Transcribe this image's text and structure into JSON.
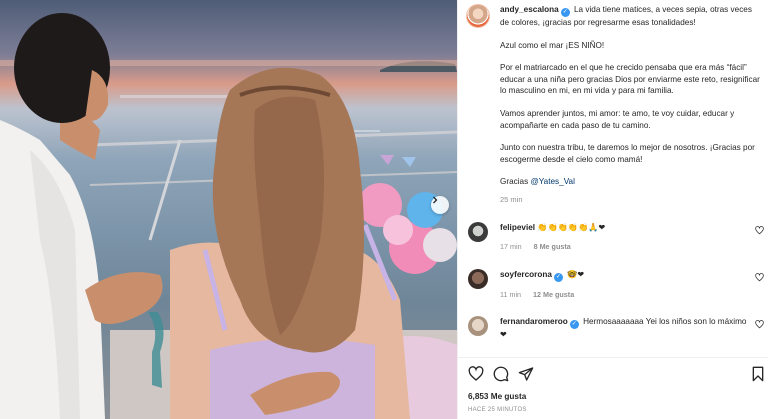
{
  "post": {
    "username": "andy_escalona",
    "caption_intro": "La vida tiene matices, a veces sepia, otras veces de colores, ¡gracias por regresarme esas tonalidades!",
    "paragraphs": [
      "Azul como el mar ¡ES NIÑO!",
      "Por el matriarcado en el que he crecido pensaba que era más “fácil” educar a una niña pero gracias Dios por enviarme este reto, resignificar lo masculino en mi, en mi vida y para mi familia.",
      "Vamos aprender juntos, mi amor: te amo, te voy cuidar, educar y acompañarte en cada paso de tu camino.",
      "Junto con nuestra tribu, te daremos lo mejor de nosotros. ¡Gracias por escogerme desde el cielo como mamá!"
    ],
    "thanks_prefix": "Gracias",
    "thanks_mention": "@Yates_Val",
    "time": "25 min"
  },
  "comments": [
    {
      "username": "felipeviel",
      "text": "👏👏👏👏👏🙏❤",
      "time": "17 min",
      "likes": "8 Me gusta"
    },
    {
      "username": "soyfercorona",
      "text": "🤓❤",
      "time": "11 min",
      "likes": "12 Me gusta"
    },
    {
      "username": "fernandaromeroo",
      "text": "Hermosaaaaaaa Yei los niños son lo máximo ❤"
    }
  ],
  "footer": {
    "likes": "6,853 Me gusta",
    "ago": "HACE 25 MINUTOS"
  },
  "icons": [
    "heart-icon",
    "comment-icon",
    "share-icon",
    "bookmark-icon",
    "chevron-right-icon",
    "verified-badge-icon"
  ],
  "colors": {
    "verified": "#3897f0",
    "mention": "#00376b",
    "heart": "#ed4956",
    "muted": "#8e8e8e"
  }
}
